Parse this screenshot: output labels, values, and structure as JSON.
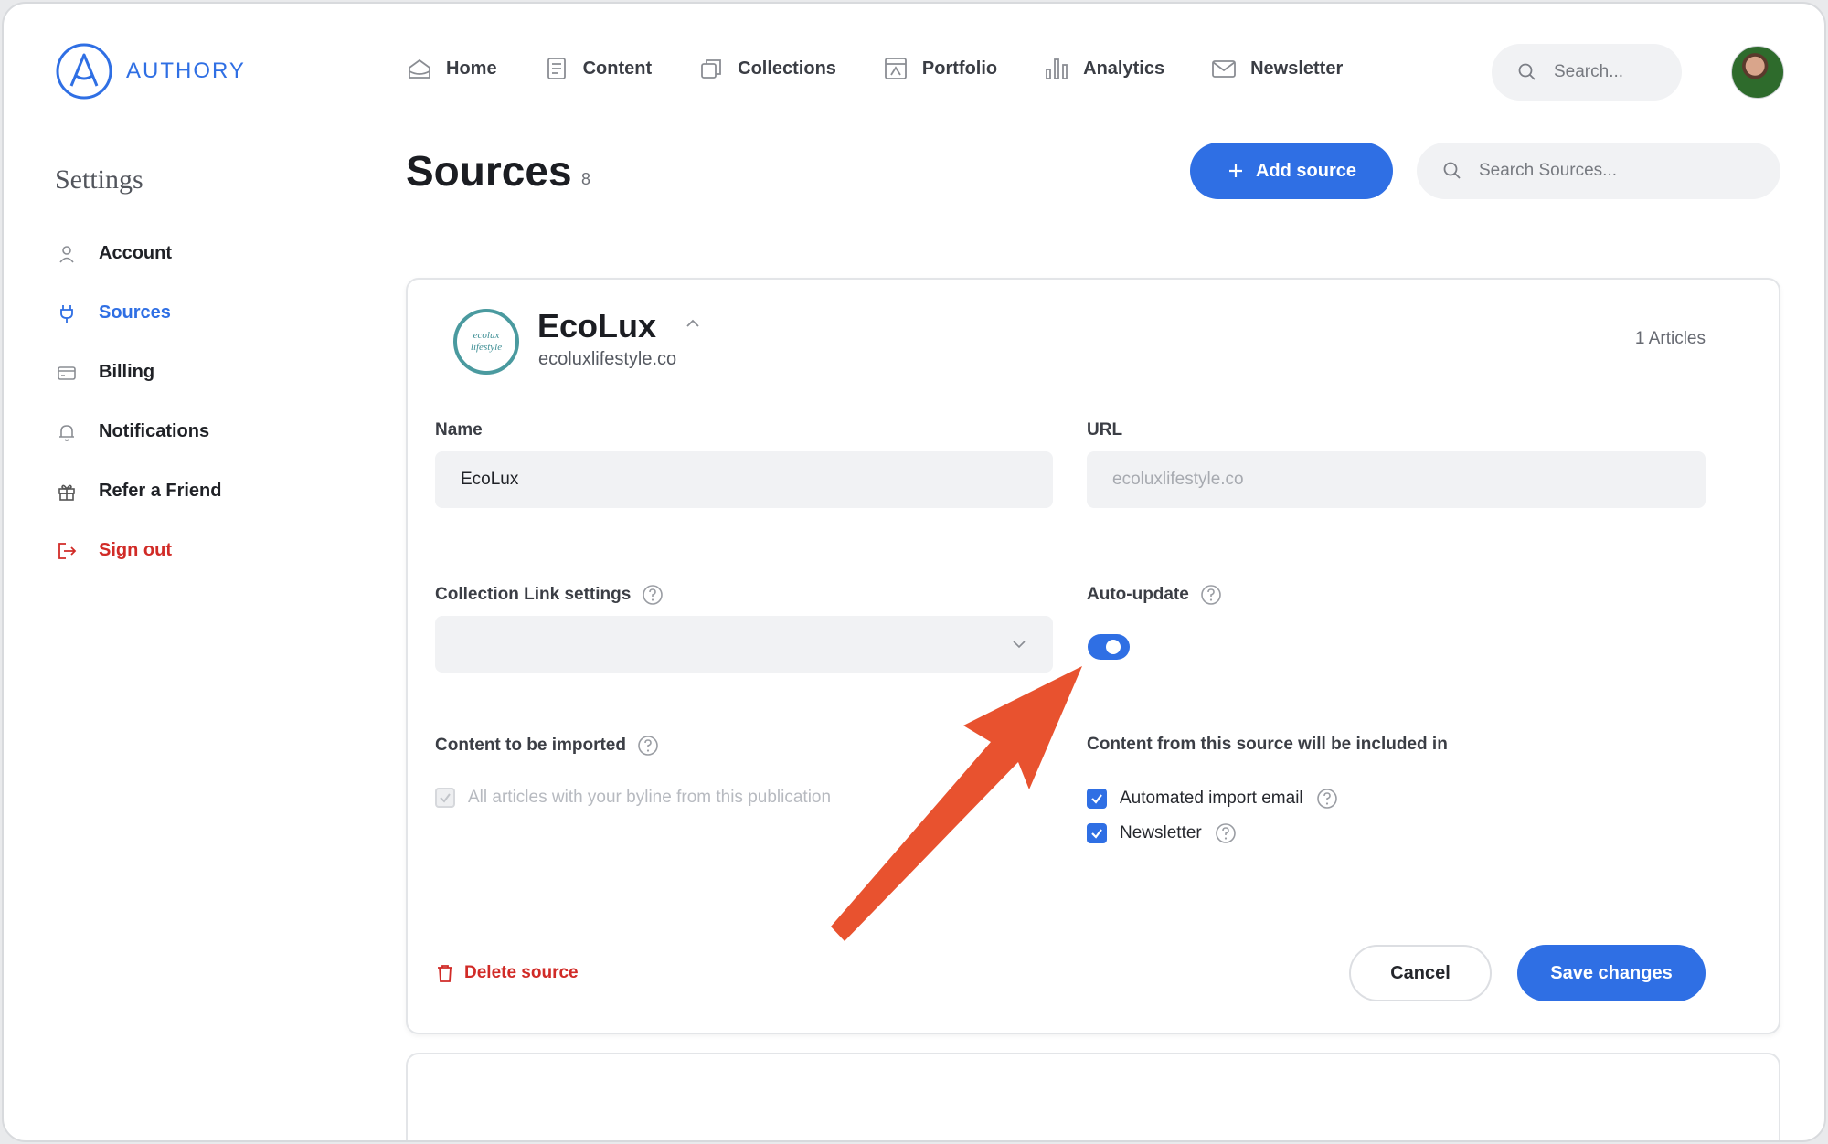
{
  "brand": {
    "name": "AUTHORY",
    "color": "#2f6fe4"
  },
  "topnav": [
    {
      "label": "Home",
      "icon": "home-icon"
    },
    {
      "label": "Content",
      "icon": "document-icon"
    },
    {
      "label": "Collections",
      "icon": "collections-icon"
    },
    {
      "label": "Portfolio",
      "icon": "portfolio-icon"
    },
    {
      "label": "Analytics",
      "icon": "bar-chart-icon"
    },
    {
      "label": "Newsletter",
      "icon": "mail-icon"
    }
  ],
  "top_search": {
    "placeholder": "Search..."
  },
  "sidebar": {
    "title": "Settings",
    "items": [
      {
        "label": "Account",
        "icon": "user-icon"
      },
      {
        "label": "Sources",
        "icon": "plug-icon",
        "active": true
      },
      {
        "label": "Billing",
        "icon": "credit-card-icon"
      },
      {
        "label": "Notifications",
        "icon": "bell-icon"
      },
      {
        "label": "Refer a Friend",
        "icon": "gift-icon"
      },
      {
        "label": "Sign out",
        "icon": "sign-out-icon"
      }
    ]
  },
  "page": {
    "title": "Sources",
    "count": "8",
    "add_button": "Add source",
    "search_placeholder": "Search Sources..."
  },
  "source": {
    "logo_text": "ecolux lifestyle",
    "name": "EcoLux",
    "domain": "ecoluxlifestyle.co",
    "articles": "1 Articles",
    "name_label": "Name",
    "name_value": "EcoLux",
    "url_label": "URL",
    "url_value": "ecoluxlifestyle.co",
    "collection_label": "Collection Link settings",
    "collection_value": "",
    "autoupdate_label": "Auto-update",
    "autoupdate_on": true,
    "content_label": "Content to be imported",
    "content_option": "All articles with your byline from this publication",
    "included_label": "Content from this source will be included in",
    "included_options": [
      {
        "label": "Automated import email",
        "checked": true
      },
      {
        "label": "Newsletter",
        "checked": true
      }
    ],
    "delete_label": "Delete source",
    "cancel_label": "Cancel",
    "save_label": "Save changes"
  },
  "colors": {
    "accent": "#2f6fe4",
    "danger": "#d12b27",
    "annotation_arrow": "#e8522f"
  }
}
